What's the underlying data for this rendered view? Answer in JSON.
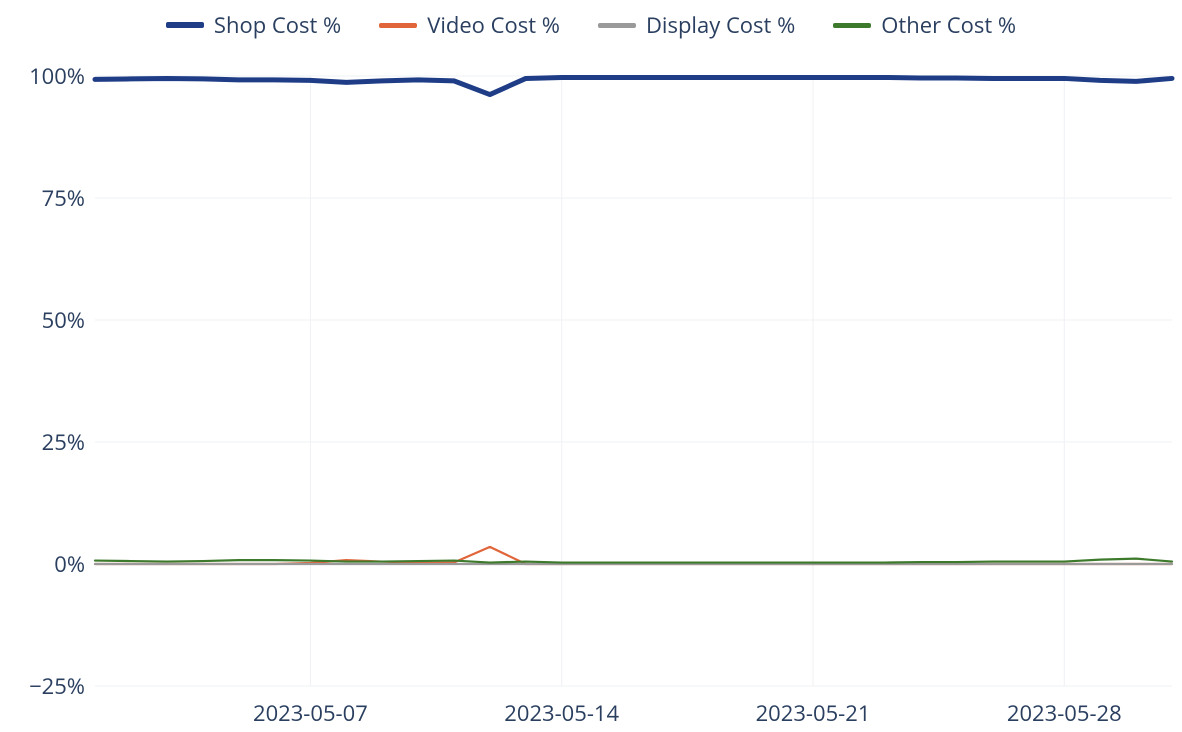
{
  "chart_data": {
    "type": "line",
    "title": "",
    "xlabel": "",
    "ylabel": "",
    "ylim": [
      -25,
      100
    ],
    "y_ticks": [
      -25,
      0,
      25,
      50,
      75,
      100
    ],
    "y_tick_labels": [
      "−25%",
      "0%",
      "25%",
      "50%",
      "75%",
      "100%"
    ],
    "x": [
      "2023-05-01",
      "2023-05-02",
      "2023-05-03",
      "2023-05-04",
      "2023-05-05",
      "2023-05-06",
      "2023-05-07",
      "2023-05-08",
      "2023-05-09",
      "2023-05-10",
      "2023-05-11",
      "2023-05-12",
      "2023-05-13",
      "2023-05-14",
      "2023-05-15",
      "2023-05-16",
      "2023-05-17",
      "2023-05-18",
      "2023-05-19",
      "2023-05-20",
      "2023-05-21",
      "2023-05-22",
      "2023-05-23",
      "2023-05-24",
      "2023-05-25",
      "2023-05-26",
      "2023-05-27",
      "2023-05-28",
      "2023-05-29",
      "2023-05-30",
      "2023-05-31"
    ],
    "x_ticks": [
      "2023-05-07",
      "2023-05-14",
      "2023-05-21",
      "2023-05-28"
    ],
    "series": [
      {
        "name": "Shop Cost %",
        "color": "#1f3d87",
        "width": 5,
        "values": [
          99.3,
          99.4,
          99.5,
          99.4,
          99.2,
          99.2,
          99.1,
          98.7,
          99.0,
          99.2,
          99.0,
          96.2,
          99.5,
          99.7,
          99.7,
          99.7,
          99.7,
          99.7,
          99.7,
          99.7,
          99.7,
          99.7,
          99.7,
          99.6,
          99.6,
          99.5,
          99.5,
          99.5,
          99.1,
          98.9,
          99.5
        ]
      },
      {
        "name": "Video Cost %",
        "color": "#e1653a",
        "width": 2.2,
        "values": [
          0.0,
          0.0,
          0.0,
          0.0,
          0.0,
          0.0,
          0.2,
          0.8,
          0.5,
          0.2,
          0.3,
          3.5,
          0.0,
          0.0,
          0.0,
          0.0,
          0.0,
          0.0,
          0.0,
          0.0,
          0.0,
          0.0,
          0.0,
          0.0,
          0.0,
          0.0,
          0.0,
          0.0,
          0.0,
          0.0,
          0.0
        ]
      },
      {
        "name": "Display Cost %",
        "color": "#9a9a9a",
        "width": 2.2,
        "values": [
          0.0,
          0.0,
          0.0,
          0.0,
          0.0,
          0.0,
          0.0,
          0.0,
          0.0,
          0.0,
          0.0,
          0.0,
          0.0,
          0.0,
          0.0,
          0.0,
          0.0,
          0.0,
          0.0,
          0.0,
          0.0,
          0.0,
          0.0,
          0.0,
          0.0,
          0.0,
          0.0,
          0.0,
          0.0,
          0.0,
          0.0
        ]
      },
      {
        "name": "Other Cost %",
        "color": "#3d7a2c",
        "width": 2.2,
        "values": [
          0.7,
          0.6,
          0.5,
          0.6,
          0.8,
          0.8,
          0.7,
          0.5,
          0.5,
          0.6,
          0.7,
          0.3,
          0.5,
          0.3,
          0.3,
          0.3,
          0.3,
          0.3,
          0.3,
          0.3,
          0.3,
          0.3,
          0.3,
          0.4,
          0.4,
          0.5,
          0.5,
          0.5,
          0.9,
          1.1,
          0.5
        ]
      }
    ],
    "legend_position": "top"
  }
}
